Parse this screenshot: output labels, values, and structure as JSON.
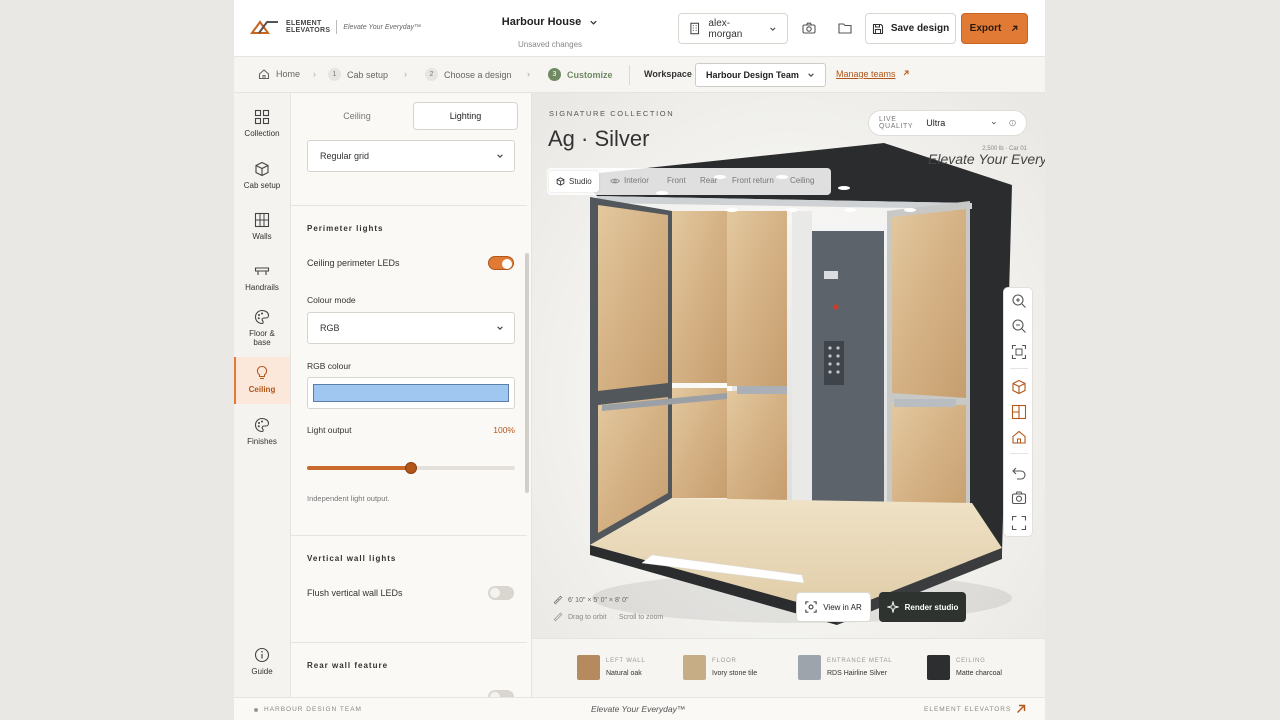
{
  "brand": {
    "name_line1": "ELEMENT",
    "name_line2": "ELEVATORS",
    "tagline": "Elevate Your Everyday™"
  },
  "project": {
    "title": "Harbour House",
    "status": "Unsaved changes"
  },
  "header": {
    "user": "alex-morgan",
    "save_label": "Save design",
    "export_label": "Export"
  },
  "breadcrumb": {
    "home": "Home",
    "steps": [
      {
        "num": "1",
        "label": "Cab setup"
      },
      {
        "num": "2",
        "label": "Choose a design"
      },
      {
        "num": "3",
        "label": "Customize"
      }
    ],
    "workspace_label": "Workspace",
    "workspace_value": "Harbour Design Team",
    "manage_label": "Manage teams"
  },
  "nav": {
    "items": [
      {
        "label": "Collection"
      },
      {
        "label": "Cab setup"
      },
      {
        "label": "Walls"
      },
      {
        "label": "Handrails"
      },
      {
        "label": "Floor &",
        "label2": "base"
      },
      {
        "label": "Ceiling"
      },
      {
        "label": "Finishes"
      }
    ],
    "guide": "Guide"
  },
  "panel": {
    "tabs": [
      "Ceiling",
      "Lighting"
    ],
    "layout_value": "Regular grid",
    "perimeter": {
      "title": "Perimeter lights",
      "toggle_label": "Ceiling perimeter LEDs",
      "toggle_on": true,
      "colour_mode_label": "Colour mode",
      "colour_mode_value": "RGB",
      "rgb_label": "RGB colour",
      "rgb_value": "#9fc7ef",
      "output_label": "Light output",
      "output_value": "100%",
      "output_slider_fraction": 0.5,
      "hint": "Independent light output."
    },
    "vertical": {
      "title": "Vertical wall lights",
      "toggle_label": "Flush vertical wall LEDs",
      "toggle_on": false
    },
    "rear": {
      "title": "Rear wall feature"
    }
  },
  "viewport": {
    "eyebrow": "SIGNATURE COLLECTION",
    "model": "Ag · Silver",
    "quality_label": "LIVE QUALITY",
    "quality_value": "Ultra",
    "spec": "2,500 lb · Car 01",
    "brand_overlay": "Elevate Your Everyday",
    "views": [
      "Studio",
      "Interior",
      "Front",
      "Rear",
      "Front return",
      "Ceiling"
    ],
    "dimensions": "6' 10\" × 5' 0\" × 8' 0\"",
    "orbit_hint": "Drag to orbit",
    "zoom_hint": "Scroll to zoom",
    "ar_label": "View in AR",
    "render_label": "Render studio"
  },
  "materials": [
    {
      "category": "LEFT WALL",
      "name": "Natural oak",
      "color": "#b58a5e"
    },
    {
      "category": "FLOOR",
      "name": "Ivory stone tile",
      "color": "#c6ad85"
    },
    {
      "category": "ENTRANCE METAL",
      "name": "RDS Hairline Silver",
      "color": "#9ea4ab"
    },
    {
      "category": "CEILING",
      "name": "Matte charcoal",
      "color": "#2d2e2f"
    }
  ],
  "footer": {
    "left": "HARBOUR DESIGN TEAM",
    "middle": "Elevate Your Everyday™",
    "right": "ELEMENT ELEVATORS"
  },
  "colors": {
    "accent": "#e07a35",
    "accent_dark": "#b2561a",
    "step_active": "#6f8a63"
  }
}
